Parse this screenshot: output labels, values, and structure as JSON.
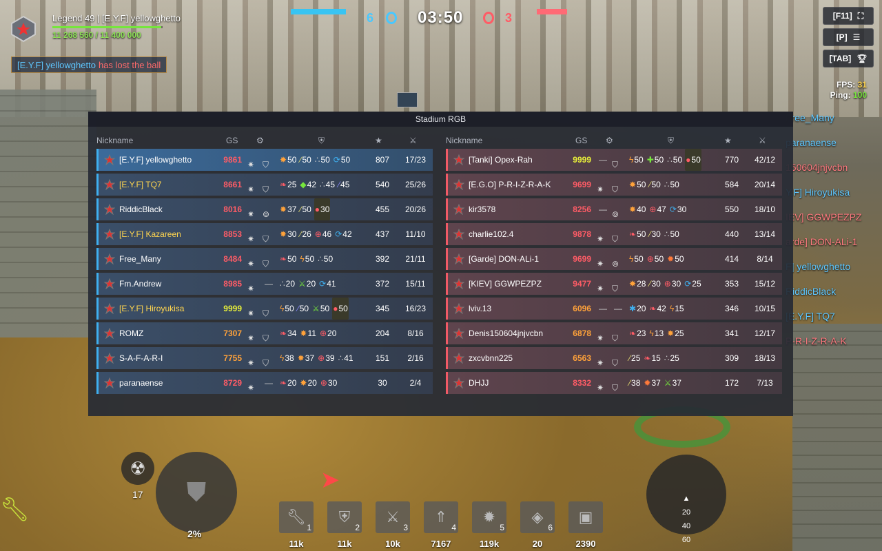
{
  "player": {
    "label": "Legend 49 | [E.Y.F] yellowghetto",
    "xp": "11 268 560 / 11 400 000",
    "xp_fraction": 0.988
  },
  "kill_message": {
    "name": "[E.Y.F] yellowghetto",
    "action": "has lost the ball"
  },
  "match": {
    "blue_score": "6",
    "red_score": "3",
    "timer": "03:50"
  },
  "keys": [
    {
      "label": "[F11]",
      "icon": "fullscreen-icon"
    },
    {
      "label": "[P]",
      "icon": "menu-icon"
    },
    {
      "label": "[TAB]",
      "icon": "trophy-icon"
    }
  ],
  "perf": {
    "fps_label": "FPS:",
    "fps": "31",
    "ping_label": "Ping:",
    "ping": "100"
  },
  "side_feed": [
    {
      "text": "Free_Many",
      "team": "b"
    },
    {
      "text": "paranaense",
      "team": "b"
    },
    {
      "text": "150604jnjvcbn",
      "team": "r"
    },
    {
      "text": "Y.F] Hiroyukisa",
      "team": "b"
    },
    {
      "text": "IEV] GGWPEZPZ",
      "team": "r"
    },
    {
      "text": "arde] DON-ALi-1",
      "team": "r"
    },
    {
      "text": "F] yellowghetto",
      "team": "b"
    },
    {
      "text": "RiddicBlack",
      "team": "b"
    },
    {
      "text": "[E.Y.F] TQ7",
      "team": "b"
    },
    {
      "text": "P-R-I-Z-R-A-K",
      "team": "r"
    }
  ],
  "board": {
    "title": "Stadium RGB",
    "headers": {
      "nickname": "Nickname",
      "gs": "GS"
    },
    "blue": [
      {
        "nick": "[E.Y.F] yellowghetto",
        "gold": false,
        "gs": "9861",
        "gs_color": "red",
        "me": true,
        "eq": [
          "turret",
          "hull"
        ],
        "mods": [
          [
            "✸",
            "50",
            "#ffa23a"
          ],
          [
            "⁄",
            "50",
            "#e8e070"
          ],
          [
            "∴",
            "50",
            "#ccc"
          ],
          [
            "⟳",
            "50",
            "#3fb0f0"
          ]
        ],
        "score": "807",
        "kd": "17/23"
      },
      {
        "nick": "[E.Y.F] TQ7",
        "gold": true,
        "gs": "8661",
        "gs_color": "red",
        "eq": [
          "turret",
          "hull"
        ],
        "mods": [
          [
            "❧",
            "25",
            "#ff5c66"
          ],
          [
            "◆",
            "42",
            "#76e63c"
          ],
          [
            "∴",
            "45",
            "#ccc"
          ],
          [
            "⁄",
            "45",
            "#8a8aff"
          ]
        ],
        "score": "540",
        "kd": "25/26"
      },
      {
        "nick": "RiddicBlack",
        "gold": false,
        "gs": "8016",
        "gs_color": "red",
        "eq": [
          "turret",
          "bag"
        ],
        "mods": [
          [
            "✸",
            "37",
            "#ffa23a"
          ],
          [
            "⁄",
            "50",
            "#e8e070"
          ],
          [
            "●",
            "30",
            "#ff5c66",
            true
          ]
        ],
        "score": "455",
        "kd": "20/26"
      },
      {
        "nick": "[E.Y.F] Kazareen",
        "gold": true,
        "gs": "8853",
        "gs_color": "red",
        "eq": [
          "turret",
          "hull"
        ],
        "mods": [
          [
            "✸",
            "30",
            "#ffa23a"
          ],
          [
            "⁄",
            "26",
            "#e8e070"
          ],
          [
            "⊕",
            "46",
            "#ff5c66"
          ],
          [
            "⟳",
            "42",
            "#3fb0f0"
          ]
        ],
        "score": "437",
        "kd": "11/10"
      },
      {
        "nick": "Free_Many",
        "gold": false,
        "gs": "8484",
        "gs_color": "red",
        "eq": [
          "turret",
          "hull"
        ],
        "mods": [
          [
            "❧",
            "50",
            "#ff5c66"
          ],
          [
            "ϟ",
            "50",
            "#ffa23a"
          ],
          [
            "∴",
            "50",
            "#ccc"
          ]
        ],
        "score": "392",
        "kd": "21/11"
      },
      {
        "nick": "Fm.Andrew",
        "gold": false,
        "gs": "8985",
        "gs_color": "red",
        "eq": [
          "turret",
          "—"
        ],
        "mods": [
          [
            "∴",
            "20",
            "#ccc"
          ],
          [
            "⚔",
            "20",
            "#76e63c"
          ],
          [
            "⟳",
            "41",
            "#3fb0f0"
          ]
        ],
        "score": "372",
        "kd": "15/11"
      },
      {
        "nick": "[E.Y.F] Hiroyukisa",
        "gold": true,
        "gs": "9999",
        "gs_color": "yellow",
        "eq": [
          "turret",
          "hull"
        ],
        "mods": [
          [
            "ϟ",
            "50",
            "#ffa23a"
          ],
          [
            "⁄",
            "50",
            "#8a8aff"
          ],
          [
            "⚔",
            "50",
            "#76e63c"
          ],
          [
            "●",
            "50",
            "#ff5c66",
            true
          ]
        ],
        "score": "345",
        "kd": "16/23"
      },
      {
        "nick": "ROMZ",
        "gold": false,
        "gs": "7307",
        "gs_color": "orange",
        "eq": [
          "turret",
          "hull"
        ],
        "mods": [
          [
            "❧",
            "34",
            "#ff5c66"
          ],
          [
            "✸",
            "11",
            "#ffa23a"
          ],
          [
            "⊕",
            "20",
            "#ff5c66"
          ]
        ],
        "score": "204",
        "kd": "8/16"
      },
      {
        "nick": "S-A-F-A-R-I",
        "gold": false,
        "gs": "7755",
        "gs_color": "orange",
        "eq": [
          "turret",
          "hull"
        ],
        "mods": [
          [
            "ϟ",
            "38",
            "#ffa23a"
          ],
          [
            "✸",
            "37",
            "#ffa23a"
          ],
          [
            "⊕",
            "39",
            "#ff5c66"
          ],
          [
            "∴",
            "41",
            "#ccc"
          ]
        ],
        "score": "151",
        "kd": "2/16"
      },
      {
        "nick": "paranaense",
        "gold": false,
        "gs": "8729",
        "gs_color": "red",
        "eq": [
          "turret",
          "—"
        ],
        "mods": [
          [
            "❧",
            "20",
            "#ff5c66"
          ],
          [
            "✸",
            "20",
            "#ffa23a"
          ],
          [
            "⊕",
            "30",
            "#ff5c66"
          ]
        ],
        "score": "30",
        "kd": "2/4"
      }
    ],
    "red": [
      {
        "nick": "[Tanki] Opex-Rah",
        "gs": "9999",
        "gs_color": "yellow",
        "eq": [
          "—",
          "hull"
        ],
        "mods": [
          [
            "ϟ",
            "50",
            "#ffa23a"
          ],
          [
            "✚",
            "50",
            "#76e63c"
          ],
          [
            "∴",
            "50",
            "#ccc"
          ],
          [
            "●",
            "50",
            "#ff5c66",
            true
          ]
        ],
        "score": "770",
        "kd": "42/12"
      },
      {
        "nick": "[E.G.O] P-R-I-Z-R-A-K",
        "gs": "9699",
        "gs_color": "red",
        "eq": [
          "turret",
          "hull"
        ],
        "mods": [
          [
            "✸",
            "50",
            "#ffa23a"
          ],
          [
            "⁄",
            "50",
            "#e8e070"
          ],
          [
            "∴",
            "50",
            "#ccc"
          ]
        ],
        "score": "584",
        "kd": "20/14"
      },
      {
        "nick": "kir3578",
        "gs": "8256",
        "gs_color": "red",
        "eq": [
          "—",
          "bag"
        ],
        "mods": [
          [
            "✸",
            "40",
            "#ffa23a"
          ],
          [
            "⊕",
            "47",
            "#ff5c66"
          ],
          [
            "⟳",
            "30",
            "#3fb0f0"
          ]
        ],
        "score": "550",
        "kd": "18/10"
      },
      {
        "nick": "charlie102.4",
        "gs": "9878",
        "gs_color": "red",
        "eq": [
          "turret",
          "hull"
        ],
        "mods": [
          [
            "❧",
            "50",
            "#ff5c66"
          ],
          [
            "⁄",
            "30",
            "#e8e070"
          ],
          [
            "∴",
            "50",
            "#ccc"
          ]
        ],
        "score": "440",
        "kd": "13/14"
      },
      {
        "nick": "[Garde] DON-ALi-1",
        "gs": "9699",
        "gs_color": "red",
        "eq": [
          "turret",
          "bag"
        ],
        "mods": [
          [
            "ϟ",
            "50",
            "#ffa23a"
          ],
          [
            "⊕",
            "50",
            "#ff5c66"
          ],
          [
            "✹",
            "50",
            "#ff7a3a"
          ]
        ],
        "score": "414",
        "kd": "8/14"
      },
      {
        "nick": "[KIEV] GGWPEZPZ",
        "gs": "9477",
        "gs_color": "red",
        "eq": [
          "turret",
          "hull"
        ],
        "mods": [
          [
            "✸",
            "28",
            "#ffa23a"
          ],
          [
            "⁄",
            "30",
            "#e8e070"
          ],
          [
            "⊕",
            "30",
            "#ff5c66"
          ],
          [
            "⟳",
            "25",
            "#3fb0f0"
          ]
        ],
        "score": "353",
        "kd": "15/12"
      },
      {
        "nick": "lviv.13",
        "gs": "6096",
        "gs_color": "orange",
        "eq": [
          "—",
          "—"
        ],
        "mods": [
          [
            "✱",
            "20",
            "#3fb0f0"
          ],
          [
            "❧",
            "42",
            "#ff5c66"
          ],
          [
            "ϟ",
            "15",
            "#ffa23a"
          ]
        ],
        "score": "346",
        "kd": "10/15"
      },
      {
        "nick": "Denis150604jnjvcbn",
        "gs": "6878",
        "gs_color": "orange",
        "eq": [
          "turret",
          "hull"
        ],
        "mods": [
          [
            "❧",
            "23",
            "#ff5c66"
          ],
          [
            "ϟ",
            "13",
            "#ffa23a"
          ],
          [
            "✸",
            "25",
            "#ffa23a"
          ]
        ],
        "score": "341",
        "kd": "12/17"
      },
      {
        "nick": "zxcvbnn225",
        "gs": "6563",
        "gs_color": "orange",
        "eq": [
          "turret",
          "hull"
        ],
        "mods": [
          [
            "⁄",
            "25",
            "#e8e070"
          ],
          [
            "❧",
            "15",
            "#ff5c66"
          ],
          [
            "∴",
            "25",
            "#ccc"
          ]
        ],
        "score": "309",
        "kd": "18/13"
      },
      {
        "nick": "DHJJ",
        "gs": "8332",
        "gs_color": "red",
        "eq": [
          "turret",
          "hull"
        ],
        "mods": [
          [
            "⁄",
            "38",
            "#e8e070"
          ],
          [
            "✹",
            "37",
            "#ff7a3a"
          ],
          [
            "⚔",
            "37",
            "#76e63c"
          ]
        ],
        "score": "172",
        "kd": "7/13"
      }
    ]
  },
  "hud": {
    "nuke_count": "17",
    "percent": "2%",
    "slots": [
      {
        "num": "1",
        "value": "11k",
        "icon": "wrench-icon"
      },
      {
        "num": "2",
        "value": "11k",
        "icon": "shield-icon"
      },
      {
        "num": "3",
        "value": "10k",
        "icon": "damage-icon"
      },
      {
        "num": "4",
        "value": "7167",
        "icon": "speed-icon"
      },
      {
        "num": "5",
        "value": "119k",
        "icon": "mine-icon"
      },
      {
        "num": "6",
        "value": "20",
        "icon": "gold-box-icon"
      },
      {
        "num": "",
        "value": "2390",
        "icon": "drone-icon"
      }
    ],
    "aim": [
      "20",
      "40",
      "60"
    ]
  }
}
